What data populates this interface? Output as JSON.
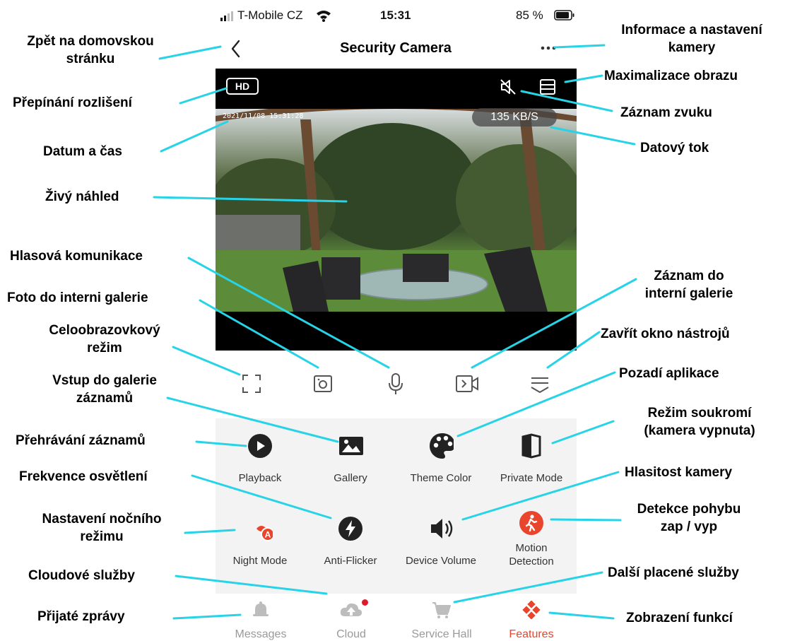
{
  "status_bar": {
    "carrier": "T-Mobile CZ",
    "time": "15:31",
    "battery": "85 %"
  },
  "header": {
    "title": "Security Camera"
  },
  "video": {
    "resolution_badge": "HD",
    "timestamp": "2021/11/08 15:31:28",
    "data_rate": "135 KB/S"
  },
  "features": [
    {
      "label": "Playback",
      "icon": "play-icon",
      "color": "#222222"
    },
    {
      "label": "Gallery",
      "icon": "image-icon",
      "color": "#222222"
    },
    {
      "label": "Theme Color",
      "icon": "palette-icon",
      "color": "#222222"
    },
    {
      "label": "Private Mode",
      "icon": "private-mode-icon",
      "color": "#222222"
    },
    {
      "label": "Night Mode",
      "icon": "night-mode-icon",
      "color": "#e8452c"
    },
    {
      "label": "Anti-Flicker",
      "icon": "flash-icon",
      "color": "#222222"
    },
    {
      "label": "Device Volume",
      "icon": "speaker-icon",
      "color": "#222222"
    },
    {
      "label": "Motion\nDetection",
      "icon": "motion-icon",
      "color": "#e8452c"
    }
  ],
  "tabs": [
    {
      "label": "Messages",
      "icon": "bell-icon",
      "active": false
    },
    {
      "label": "Cloud",
      "icon": "cloud-icon",
      "active": false
    },
    {
      "label": "Service Hall",
      "icon": "cart-icon",
      "active": false
    },
    {
      "label": "Features",
      "icon": "features-icon",
      "active": true
    }
  ],
  "colors": {
    "accent": "#e8452c",
    "inactive": "#9a9a9a",
    "notification_dot": "#e0192b"
  },
  "annotations": {
    "back": "Zpět na domovskou\nstránku",
    "resolution": "Přepínání rozlišení",
    "datetime": "Datum a čas",
    "live": "Živý náhled",
    "voice": "Hlasová komunikace",
    "photo": "Foto do interni galerie",
    "fullscreen": "Celoobrazovkový\nrežim",
    "gallery": "Vstup do galerie\nzáznamů",
    "playback": "Přehrávání záznamů",
    "flicker": "Frekvence osvětlení",
    "night": "Nastavení nočního\nrežimu",
    "cloud": "Cloudové služby",
    "messages": "Přijaté zprávy",
    "info": "Informace a nastavení\nkamery",
    "maximize": "Maximalizace obrazu",
    "sound": "Záznam zvuku",
    "rate": "Datový tok",
    "record": "Záznam do\ninterní galerie",
    "close_tools": "Zavřít okno nástrojů",
    "theme": "Pozadí aplikace",
    "privacy": "Režim soukromí\n(kamera vypnuta)",
    "volume": "Hlasitost kamery",
    "motion": "Detekce pohybu\nzap / vyp",
    "paid": "Další placené služby",
    "features": "Zobrazení funkcí"
  }
}
